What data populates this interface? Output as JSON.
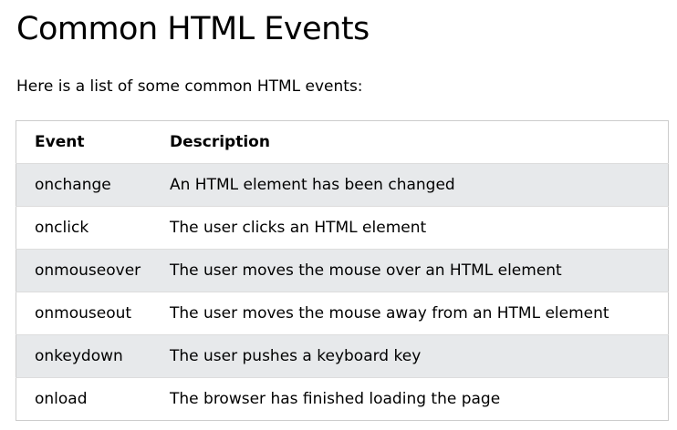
{
  "page": {
    "title": "Common HTML Events",
    "intro": "Here is a list of some common HTML events:"
  },
  "table": {
    "headers": {
      "event": "Event",
      "description": "Description"
    },
    "rows": [
      {
        "event": "onchange",
        "description": "An HTML element has been changed"
      },
      {
        "event": "onclick",
        "description": "The user clicks an HTML element"
      },
      {
        "event": "onmouseover",
        "description": "The user moves the mouse over an HTML element"
      },
      {
        "event": "onmouseout",
        "description": "The user moves the mouse away from an HTML element"
      },
      {
        "event": "onkeydown",
        "description": "The user pushes a keyboard key"
      },
      {
        "event": "onload",
        "description": "The browser has finished loading the page"
      }
    ]
  },
  "colors": {
    "stripe_row": "#e7e9eb",
    "plain_row": "#ffffff",
    "table_border": "#cccccc",
    "text": "#000000"
  }
}
